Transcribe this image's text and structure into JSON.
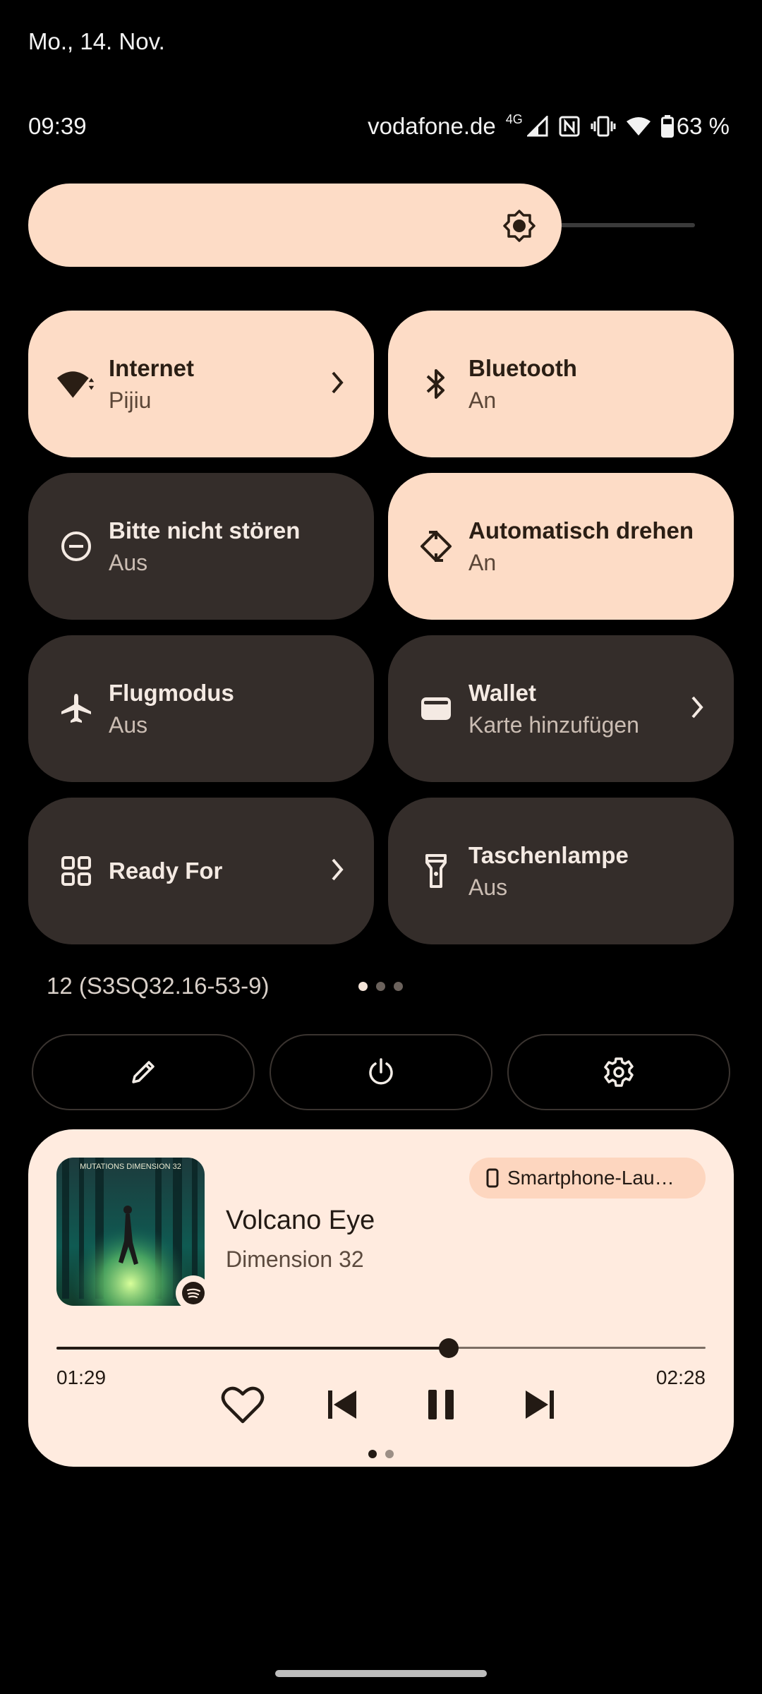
{
  "status": {
    "date": "Mo., 14. Nov.",
    "time": "09:39",
    "carrier": "vodafone.de",
    "network": "4G",
    "battery": "63 %"
  },
  "brightness": {
    "level": 0.8
  },
  "tiles": [
    {
      "title": "Internet",
      "subtitle": "Pijiu",
      "state": "on",
      "icon": "wifi-icon"
    },
    {
      "title": "Bluetooth",
      "subtitle": "An",
      "state": "on",
      "icon": "bluetooth-icon"
    },
    {
      "title": "Bitte nicht stören",
      "subtitle": "Aus",
      "state": "off",
      "icon": "do-not-disturb-icon"
    },
    {
      "title": "Automatisch drehen",
      "subtitle": "An",
      "state": "on",
      "icon": "auto-rotate-icon"
    },
    {
      "title": "Flugmodus",
      "subtitle": "Aus",
      "state": "off",
      "icon": "airplane-icon"
    },
    {
      "title": "Wallet",
      "subtitle": "Karte hinzufügen",
      "state": "off",
      "icon": "wallet-icon"
    },
    {
      "title": "Ready For",
      "subtitle": "",
      "state": "off",
      "icon": "ready-for-icon"
    },
    {
      "title": "Taschenlampe",
      "subtitle": "Aus",
      "state": "off",
      "icon": "flashlight-icon"
    }
  ],
  "build": "12 (S3SQ32.16-53-9)",
  "qs_pages": {
    "count": 3,
    "active": 0
  },
  "media": {
    "output_device": "Smartphone-Lau…",
    "title": "Volcano Eye",
    "artist": "Dimension 32",
    "position": "01:29",
    "duration": "02:28",
    "progress": 0.604,
    "album_text": "MUTATIONS DIMENSION 32",
    "pages": {
      "count": 2,
      "active": 0
    }
  },
  "colors": {
    "tile_on": "#fddcc6",
    "tile_off": "#342d2a",
    "media_bg": "#ffebdf"
  }
}
